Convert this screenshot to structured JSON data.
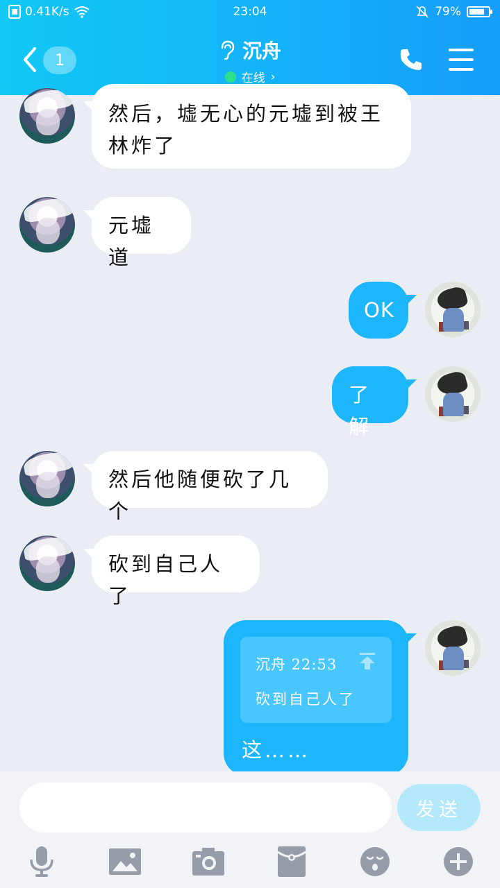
{
  "status_bar": {
    "speed": "0.41K/s",
    "time": "23:04",
    "battery": "79%",
    "battery_level": 0.79
  },
  "header": {
    "back_count": "1",
    "title": "沉舟",
    "subtitle": "在线"
  },
  "messages": [
    {
      "side": "other",
      "text_line1": "然后，墟无心的元墟到被王",
      "text_line2": "林炸了"
    },
    {
      "side": "other",
      "text": "元墟道"
    },
    {
      "side": "me",
      "text": "OK"
    },
    {
      "side": "me",
      "text": "了解"
    },
    {
      "side": "other",
      "text": "然后他随便砍了几个"
    },
    {
      "side": "other",
      "text": "砍到自己人了"
    },
    {
      "side": "me",
      "quote_head": "沉舟 22:53",
      "quote_text": "砍到自己人了",
      "text": "这……"
    }
  ],
  "composer": {
    "value": "",
    "send_label": "发送"
  },
  "toolbar": {
    "icons": [
      "microphone-icon",
      "image-icon",
      "camera-icon",
      "red-packet-icon",
      "emoji-icon",
      "plus-icon"
    ]
  },
  "colors": {
    "header_start": "#12c8f5",
    "header_end": "#169dfb",
    "my_bubble": "#1eb6fb",
    "background": "#eaedf3",
    "online": "#2fe08a"
  }
}
